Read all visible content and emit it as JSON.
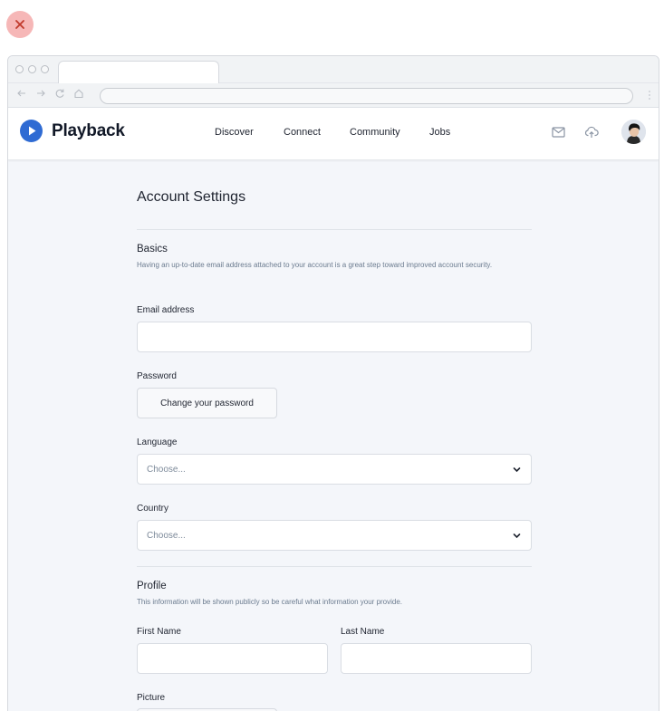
{
  "brand": {
    "name": "Playback",
    "accent": "#2f6bd3"
  },
  "nav": {
    "items": [
      "Discover",
      "Connect",
      "Community",
      "Jobs"
    ]
  },
  "icons": {
    "mail": "mail-icon",
    "upload": "upload-icon",
    "close": "close-icon"
  },
  "page": {
    "title": "Account Settings"
  },
  "basics": {
    "title": "Basics",
    "description": "Having an up-to-date email address attached to your account is a great step toward improved account security.",
    "email_label": "Email address",
    "email_value": "",
    "password_label": "Password",
    "password_button": "Change your password",
    "language_label": "Language",
    "language_value": "Choose...",
    "country_label": "Country",
    "country_value": "Choose..."
  },
  "profile": {
    "title": "Profile",
    "description": "This information will be shown publicly so be careful what information your provide.",
    "first_name_label": "First Name",
    "first_name_value": "",
    "last_name_label": "Last Name",
    "last_name_value": "",
    "picture_label": "Picture"
  }
}
